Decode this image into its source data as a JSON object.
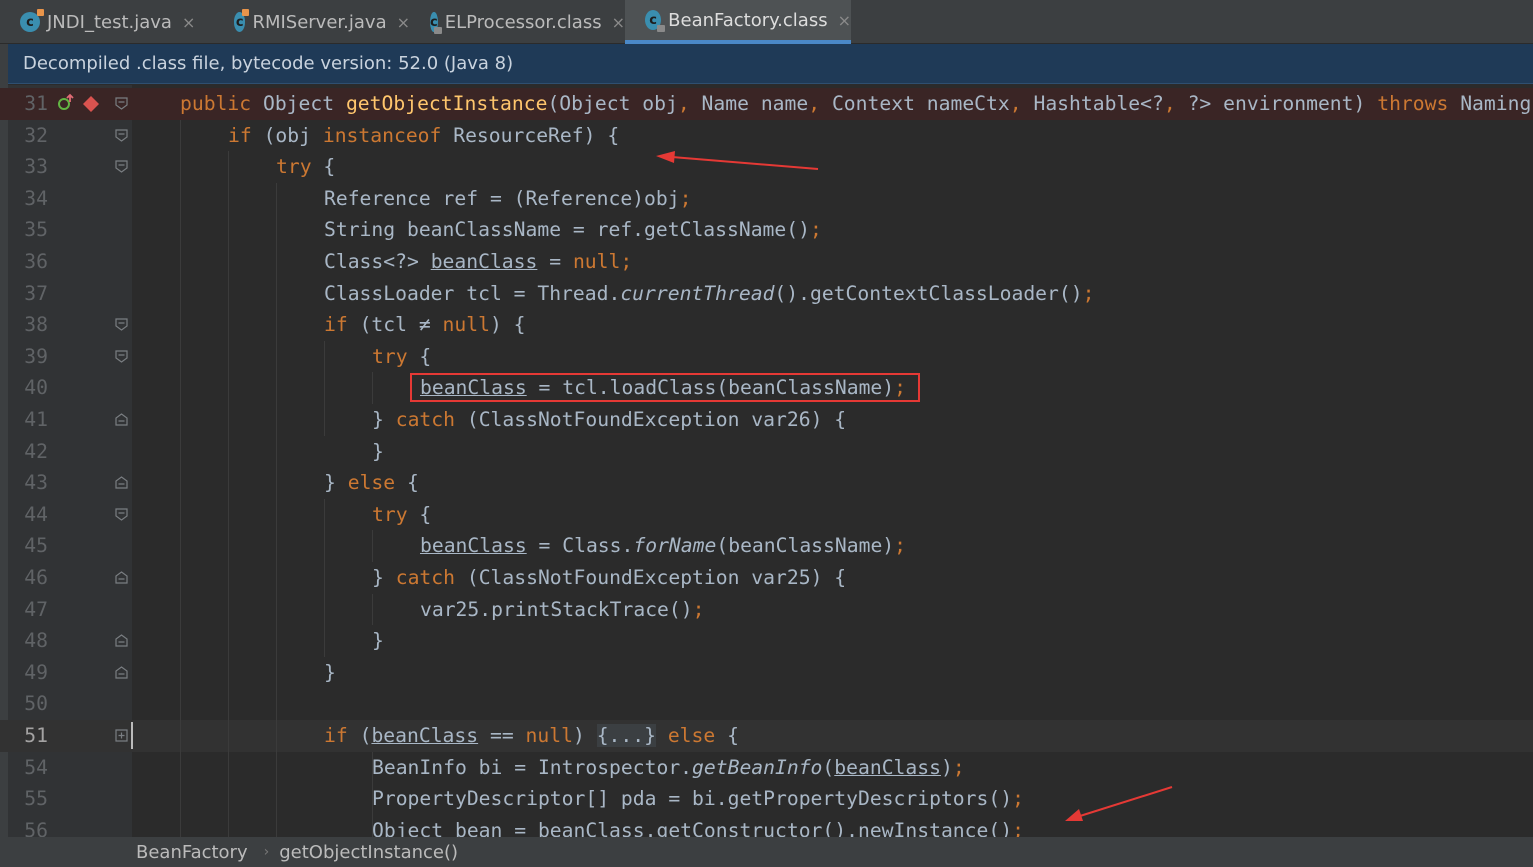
{
  "tabs": [
    {
      "label": "JNDI_test.java",
      "icon": "java-class-icon",
      "active": false
    },
    {
      "label": "RMIServer.java",
      "icon": "java-class-icon",
      "active": false
    },
    {
      "label": "ELProcessor.class",
      "icon": "compiled-class-icon",
      "active": false
    },
    {
      "label": "BeanFactory.class",
      "icon": "compiled-class-icon",
      "active": true
    }
  ],
  "tab_close_glyph": "×",
  "class_icon_letter": "c",
  "banner": "Decompiled .class file, bytecode version: 52.0 (Java 8)",
  "breadcrumb": [
    "BeanFactory",
    "getObjectInstance()"
  ],
  "breadcrumb_sep": "›",
  "colors": {
    "keyword": "#cc7832",
    "method": "#ffc66d",
    "text": "#a9b7c6",
    "highlight_box": "#e53935"
  },
  "code_lines": [
    {
      "n": "31",
      "indent": 0,
      "tokens": [
        [
          "kw",
          "public"
        ],
        [
          "t",
          " Object "
        ],
        [
          "fn",
          "getObjectInstance"
        ],
        [
          "t",
          "(Object obj"
        ],
        [
          "kw",
          ","
        ],
        [
          "t",
          " Name name"
        ],
        [
          "kw",
          ","
        ],
        [
          "t",
          " Context nameCtx"
        ],
        [
          "kw",
          ","
        ],
        [
          "t",
          " Hashtable<?"
        ],
        [
          "kw",
          ","
        ],
        [
          "t",
          " ?> environment) "
        ],
        [
          "kw",
          "throws"
        ],
        [
          "t",
          " Naming"
        ]
      ]
    },
    {
      "n": "32",
      "indent": 1,
      "tokens": [
        [
          "kw",
          "if"
        ],
        [
          "t",
          " (obj "
        ],
        [
          "kw",
          "instanceof"
        ],
        [
          "t",
          " ResourceRef) {"
        ]
      ]
    },
    {
      "n": "33",
      "indent": 2,
      "tokens": [
        [
          "kw",
          "try"
        ],
        [
          "t",
          " {"
        ]
      ]
    },
    {
      "n": "34",
      "indent": 3,
      "tokens": [
        [
          "t",
          "Reference ref = (Reference)obj"
        ],
        [
          "kw",
          ";"
        ]
      ]
    },
    {
      "n": "35",
      "indent": 3,
      "tokens": [
        [
          "t",
          "String beanClassName = ref.getClassName()"
        ],
        [
          "kw",
          ";"
        ]
      ]
    },
    {
      "n": "36",
      "indent": 3,
      "tokens": [
        [
          "t",
          "Class<?> "
        ],
        [
          "ul",
          "beanClass"
        ],
        [
          "t",
          " = "
        ],
        [
          "kw",
          "null;"
        ]
      ]
    },
    {
      "n": "37",
      "indent": 3,
      "tokens": [
        [
          "t",
          "ClassLoader tcl = Thread."
        ],
        [
          "it",
          "currentThread"
        ],
        [
          "t",
          "().getContextClassLoader()"
        ],
        [
          "kw",
          ";"
        ]
      ]
    },
    {
      "n": "38",
      "indent": 3,
      "tokens": [
        [
          "kw",
          "if"
        ],
        [
          "t",
          " (tcl ≠ "
        ],
        [
          "kw",
          "null"
        ],
        [
          "t",
          ") {"
        ]
      ]
    },
    {
      "n": "39",
      "indent": 4,
      "tokens": [
        [
          "kw",
          "try"
        ],
        [
          "t",
          " {"
        ]
      ]
    },
    {
      "n": "40",
      "indent": 5,
      "tokens": [
        [
          "ul",
          "beanClass"
        ],
        [
          "t",
          " = tcl.loadClass(beanClassName)"
        ],
        [
          "kw",
          ";"
        ]
      ]
    },
    {
      "n": "41",
      "indent": 4,
      "tokens": [
        [
          "t",
          "} "
        ],
        [
          "kw",
          "catch"
        ],
        [
          "t",
          " (ClassNotFoundException var26) {"
        ]
      ]
    },
    {
      "n": "42",
      "indent": 4,
      "tokens": [
        [
          "t",
          "}"
        ]
      ]
    },
    {
      "n": "43",
      "indent": 3,
      "tokens": [
        [
          "t",
          "} "
        ],
        [
          "kw",
          "else"
        ],
        [
          "t",
          " {"
        ]
      ]
    },
    {
      "n": "44",
      "indent": 4,
      "tokens": [
        [
          "kw",
          "try"
        ],
        [
          "t",
          " {"
        ]
      ]
    },
    {
      "n": "45",
      "indent": 5,
      "tokens": [
        [
          "ul",
          "beanClass"
        ],
        [
          "t",
          " = Class."
        ],
        [
          "it",
          "forName"
        ],
        [
          "t",
          "(beanClassName)"
        ],
        [
          "kw",
          ";"
        ]
      ]
    },
    {
      "n": "46",
      "indent": 4,
      "tokens": [
        [
          "t",
          "} "
        ],
        [
          "kw",
          "catch"
        ],
        [
          "t",
          " (ClassNotFoundException var25) {"
        ]
      ]
    },
    {
      "n": "47",
      "indent": 5,
      "tokens": [
        [
          "t",
          "var25.printStackTrace()"
        ],
        [
          "kw",
          ";"
        ]
      ]
    },
    {
      "n": "48",
      "indent": 4,
      "tokens": [
        [
          "t",
          "}"
        ]
      ]
    },
    {
      "n": "49",
      "indent": 3,
      "tokens": [
        [
          "t",
          "}"
        ]
      ]
    },
    {
      "n": "50",
      "indent": 3,
      "tokens": []
    },
    {
      "n": "51",
      "indent": 3,
      "tokens": [
        [
          "kw",
          "if"
        ],
        [
          "t",
          " ("
        ],
        [
          "ul",
          "beanClass"
        ],
        [
          "t",
          " == "
        ],
        [
          "kw",
          "null"
        ],
        [
          "t",
          ") "
        ],
        [
          "fold",
          "{...}"
        ],
        [
          "t",
          " "
        ],
        [
          "kw",
          "else"
        ],
        [
          "t",
          " {"
        ]
      ]
    },
    {
      "n": "54",
      "indent": 4,
      "tokens": [
        [
          "t",
          "BeanInfo bi = Introspector."
        ],
        [
          "it",
          "getBeanInfo"
        ],
        [
          "t",
          "("
        ],
        [
          "ul",
          "beanClass"
        ],
        [
          "t",
          ")"
        ],
        [
          "kw",
          ";"
        ]
      ]
    },
    {
      "n": "55",
      "indent": 4,
      "tokens": [
        [
          "t",
          "PropertyDescriptor[] pda = bi.getPropertyDescriptors()"
        ],
        [
          "kw",
          ";"
        ]
      ]
    },
    {
      "n": "56",
      "indent": 4,
      "tokens": [
        [
          "t",
          "Object bean = beanClass.getConstructor().newInstance()"
        ],
        [
          "kw",
          ";"
        ]
      ]
    }
  ]
}
